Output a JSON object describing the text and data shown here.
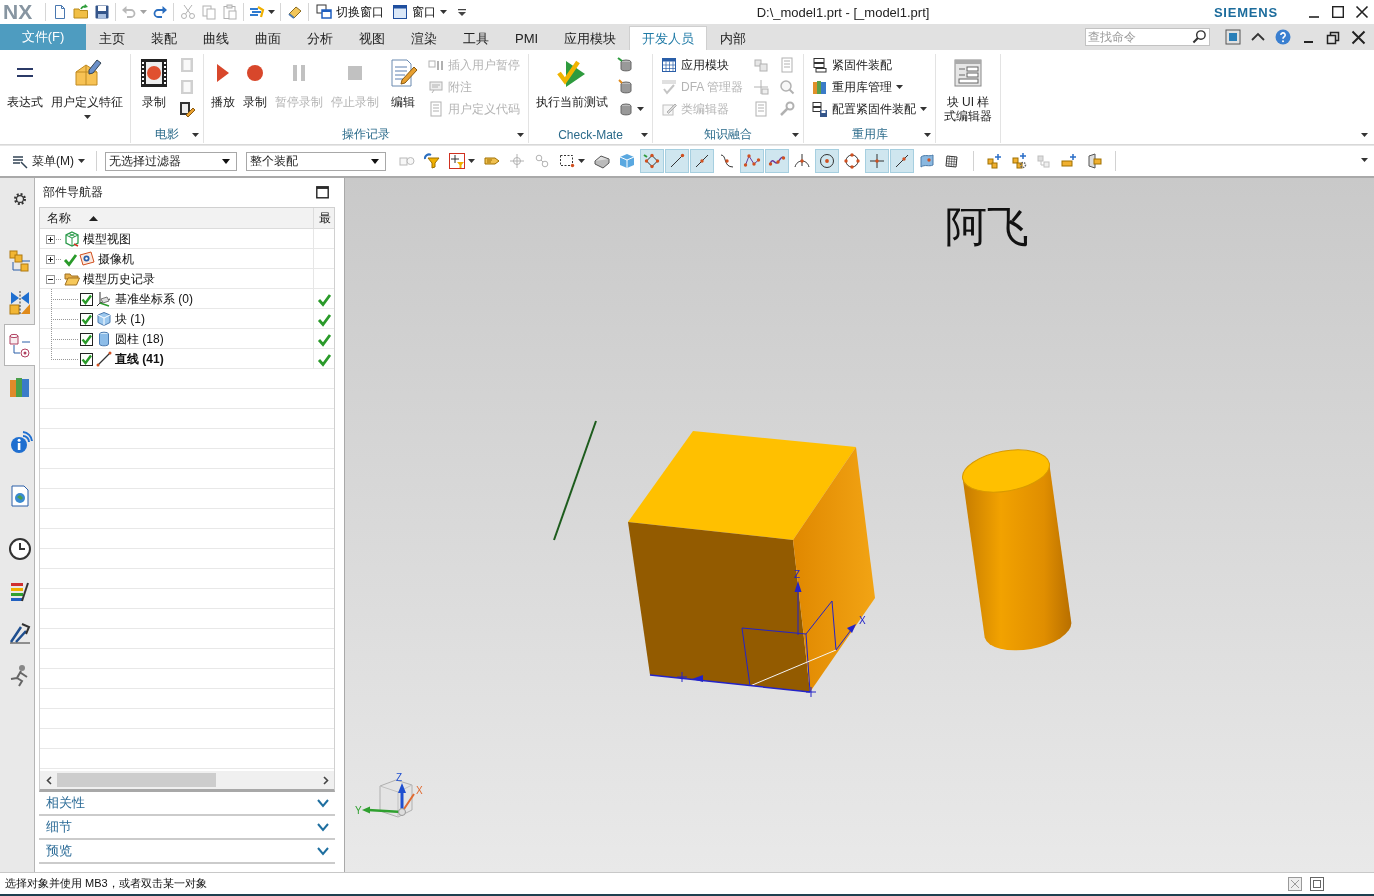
{
  "title_bar": {
    "logo": "NX",
    "quick_access": [
      {
        "disabled": false,
        "menu": false
      },
      {
        "disabled": false,
        "menu": false
      },
      {
        "disabled": false,
        "menu": false
      },
      {
        "disabled": true,
        "menu": true
      },
      {
        "disabled": false,
        "menu": false
      },
      {
        "disabled": true,
        "menu": false
      },
      {
        "disabled": true,
        "menu": false
      },
      {
        "disabled": true,
        "menu": false
      },
      {
        "disabled": false,
        "menu": true
      },
      {
        "disabled": false,
        "menu": false
      }
    ],
    "window_buttons": [
      {
        "label": "切换窗口",
        "menu": false
      },
      {
        "label": "窗口",
        "menu": true
      }
    ],
    "title": "D:\\_model1.prt - [_model1.prt]",
    "brand": "SIEMENS"
  },
  "ribbon": {
    "file_tab": "文件(F)",
    "tabs": [
      {
        "label": "主页",
        "selected": false
      },
      {
        "label": "装配",
        "selected": false
      },
      {
        "label": "曲线",
        "selected": false
      },
      {
        "label": "曲面",
        "selected": false
      },
      {
        "label": "分析",
        "selected": false
      },
      {
        "label": "视图",
        "selected": false
      },
      {
        "label": "渲染",
        "selected": false
      },
      {
        "label": "工具",
        "selected": false
      },
      {
        "label": "PMI",
        "selected": false
      },
      {
        "label": "应用模块",
        "selected": false
      },
      {
        "label": "开发人员",
        "selected": true
      },
      {
        "label": "内部",
        "selected": false
      }
    ],
    "search": {
      "placeholder": "查找命令"
    },
    "groups": [
      {
        "items": [
          {
            "kind": "large",
            "label": "表达式",
            "disabled": false,
            "menu": false
          },
          {
            "kind": "large",
            "label": "用户定义特征",
            "disabled": false,
            "menu": true
          }
        ]
      },
      {
        "label": "电影",
        "items": [
          {
            "kind": "large",
            "label": "录制",
            "disabled": false,
            "menu": false
          },
          {
            "kind": "small",
            "disabled": true,
            "menu": false
          },
          {
            "kind": "small",
            "disabled": true,
            "menu": false
          },
          {
            "kind": "small",
            "disabled": false,
            "menu": false
          }
        ]
      },
      {
        "label": "操作记录",
        "items": [
          {
            "kind": "large",
            "label": "播放",
            "disabled": false,
            "menu": false
          },
          {
            "kind": "large",
            "label": "录制",
            "disabled": false,
            "menu": false
          },
          {
            "kind": "large",
            "label": "暂停录制",
            "disabled": true,
            "menu": false
          },
          {
            "kind": "large",
            "label": "停止录制",
            "disabled": true,
            "menu": false
          },
          {
            "kind": "large",
            "label": "编辑",
            "disabled": false,
            "menu": false
          },
          {
            "kind": "small",
            "label": "插入用户暂停",
            "disabled": true,
            "menu": false
          },
          {
            "kind": "small",
            "label": "附注",
            "disabled": true,
            "menu": false
          },
          {
            "kind": "small",
            "label": "用户定义代码",
            "disabled": true,
            "menu": false
          }
        ]
      },
      {
        "label": "Check-Mate",
        "items": [
          {
            "kind": "large",
            "label": "执行当前测试",
            "disabled": false,
            "menu": false
          },
          {
            "kind": "small",
            "disabled": false,
            "menu": false
          },
          {
            "kind": "small",
            "disabled": false,
            "menu": false
          },
          {
            "kind": "small",
            "disabled": false,
            "menu": true
          }
        ]
      },
      {
        "label": "知识融合",
        "items": [
          {
            "kind": "small",
            "label": "应用模块",
            "disabled": false,
            "menu": false
          },
          {
            "kind": "small",
            "label": "DFA 管理器",
            "disabled": true,
            "menu": false
          },
          {
            "kind": "small",
            "label": "类编辑器",
            "disabled": true,
            "menu": false
          },
          {
            "kind": "small",
            "disabled": true,
            "menu": false
          },
          {
            "kind": "small",
            "disabled": true,
            "menu": false
          },
          {
            "kind": "small",
            "disabled": true,
            "menu": false
          },
          {
            "kind": "small",
            "disabled": true,
            "menu": false
          },
          {
            "kind": "small",
            "disabled": true,
            "menu": false
          },
          {
            "kind": "small",
            "disabled": true,
            "menu": false
          }
        ]
      },
      {
        "label": "重用库",
        "items": [
          {
            "kind": "small",
            "label": "紧固件装配",
            "disabled": false,
            "menu": false
          },
          {
            "kind": "small",
            "label": "重用库管理",
            "disabled": false,
            "menu": true
          },
          {
            "kind": "small",
            "label": "配置紧固件装配",
            "disabled": false,
            "menu": true
          }
        ]
      },
      {
        "items": [
          {
            "kind": "large",
            "label": "块 UI 样式编辑器",
            "disabled": false,
            "menu": false
          }
        ]
      }
    ]
  },
  "toolbar": {
    "menu_button": "菜单(M)",
    "filters": [
      {
        "value": "无选择过滤器"
      },
      {
        "value": "整个装配"
      }
    ],
    "tool_groups": [
      {
        "tools": [
          {
            "selected": false,
            "menu": false,
            "disabled": true
          },
          {
            "selected": false,
            "menu": false,
            "disabled": false
          },
          {
            "selected": false,
            "menu": true,
            "disabled": false
          },
          {
            "selected": false,
            "menu": false,
            "disabled": false
          },
          {
            "selected": false,
            "menu": false,
            "disabled": true
          },
          {
            "selected": false,
            "menu": false,
            "disabled": true
          },
          {
            "selected": false,
            "menu": true,
            "disabled": false
          },
          {
            "selected": false,
            "menu": false,
            "disabled": false
          },
          {
            "selected": false,
            "menu": false,
            "disabled": false
          },
          {
            "selected": true,
            "menu": false,
            "disabled": false
          },
          {
            "selected": true,
            "menu": false,
            "disabled": false
          },
          {
            "selected": true,
            "menu": false,
            "disabled": false
          },
          {
            "selected": false,
            "menu": false,
            "disabled": false
          },
          {
            "selected": true,
            "menu": false,
            "disabled": false
          },
          {
            "selected": true,
            "menu": false,
            "disabled": false
          },
          {
            "selected": false,
            "menu": false,
            "disabled": false
          },
          {
            "selected": true,
            "menu": false,
            "disabled": false
          },
          {
            "selected": false,
            "menu": false,
            "disabled": false
          },
          {
            "selected": true,
            "menu": false,
            "disabled": false
          },
          {
            "selected": true,
            "menu": false,
            "disabled": false
          },
          {
            "selected": false,
            "menu": false,
            "disabled": false
          },
          {
            "selected": false,
            "menu": false,
            "disabled": false
          }
        ]
      },
      {
        "tools": [
          {
            "selected": false,
            "menu": false,
            "disabled": false
          },
          {
            "selected": false,
            "menu": false,
            "disabled": false
          },
          {
            "selected": false,
            "menu": false,
            "disabled": true
          },
          {
            "selected": false,
            "menu": false,
            "disabled": false
          },
          {
            "selected": false,
            "menu": false,
            "disabled": false
          }
        ]
      }
    ]
  },
  "resource_bar": [
    {
      "selected": false
    },
    {
      "selected": false
    },
    {
      "selected": false
    },
    {
      "selected": true
    },
    {
      "selected": false
    },
    {
      "selected": false
    },
    {
      "selected": false
    },
    {
      "selected": false
    },
    {
      "selected": false
    },
    {
      "selected": false
    },
    {
      "selected": false
    }
  ],
  "navigator": {
    "title": "部件导航器",
    "columns": [
      {
        "label": "名称",
        "sort_ascending": true
      },
      {
        "label": "最"
      }
    ],
    "tree": [
      {
        "label": "模型视图",
        "expanded": false,
        "ticked": false,
        "column_2_tick": false
      },
      {
        "label": "摄像机",
        "expanded": false,
        "ticked": true,
        "column_2_tick": false
      },
      {
        "label": "模型历史记录",
        "expanded": true,
        "ticked": false,
        "column_2_tick": false,
        "children": [
          {
            "label": "基准坐标系 (0)",
            "checked": true,
            "current": false,
            "column_2_tick": true
          },
          {
            "label": "块 (1)",
            "checked": true,
            "current": false,
            "column_2_tick": true
          },
          {
            "label": "圆柱 (18)",
            "checked": true,
            "current": false,
            "column_2_tick": true
          },
          {
            "label": "直线 (41)",
            "checked": true,
            "current": true,
            "column_2_tick": true
          }
        ]
      }
    ],
    "sections": [
      {
        "label": "相关性",
        "expanded": false
      },
      {
        "label": "细节",
        "expanded": false
      },
      {
        "label": "预览",
        "expanded": false
      }
    ]
  },
  "viewport": {
    "label": "阿飞",
    "datum_labels": [
      "Z",
      "X"
    ],
    "triad_labels": [
      "Z",
      "X",
      "Y"
    ]
  },
  "status_bar": {
    "message": "选择对象并使用 MB3，或者双击某一对象"
  }
}
